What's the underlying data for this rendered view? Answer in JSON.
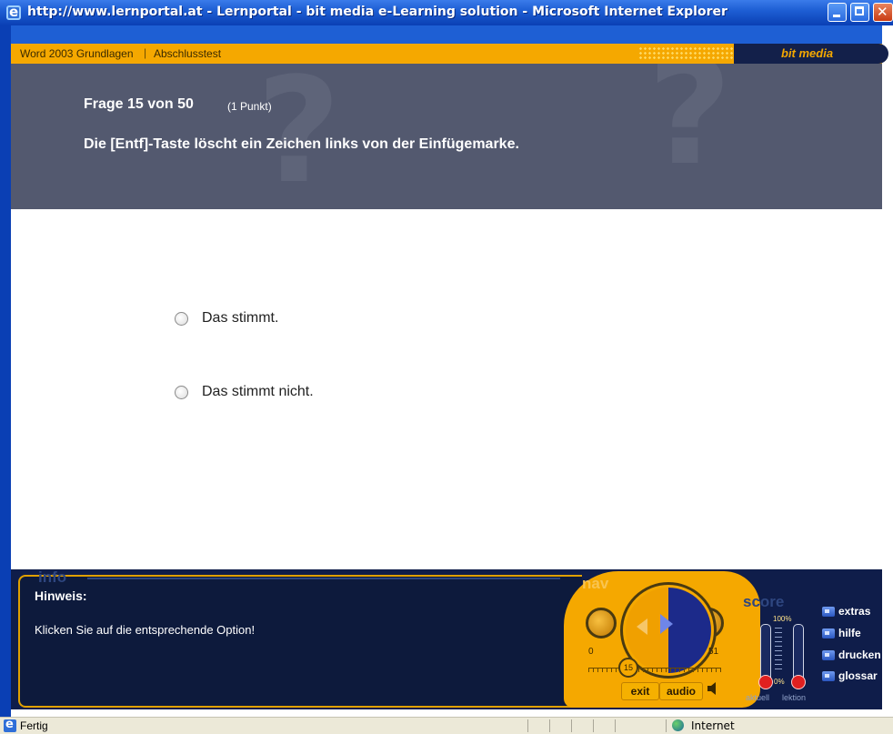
{
  "window": {
    "title": "http://www.lernportal.at - Lernportal - bit media e-Learning solution - Microsoft Internet Explorer"
  },
  "course_bar": {
    "course": "Word 2003 Grundlagen",
    "separator": "|",
    "section": "Abschlusstest",
    "brand": "bit media"
  },
  "question": {
    "number_label": "Frage 15 von 50",
    "points_label": "(1 Punkt)",
    "text": "Die [Entf]-Taste löscht ein Zeichen links von der Einfügemarke."
  },
  "answers": [
    {
      "label": "Das stimmt.",
      "selected": false
    },
    {
      "label": "Das stimmt nicht.",
      "selected": false
    }
  ],
  "info_panel": {
    "title": "info",
    "hint_title": "Hinweis:",
    "hint_text": "Klicken Sie auf die entsprechende Option!"
  },
  "nav": {
    "title": "nav",
    "slider_min": "0",
    "slider_max": "51",
    "slider_value": "15",
    "exit_label": "exit",
    "audio_label": "audio"
  },
  "score": {
    "title": "score",
    "max_label": "100%",
    "min_label": "0%",
    "aktuell_label": "aktuell",
    "lektion_label": "lektion"
  },
  "side_menu": [
    {
      "label": "extras"
    },
    {
      "label": "hilfe"
    },
    {
      "label": "drucken"
    },
    {
      "label": "glossar"
    }
  ],
  "status_bar": {
    "status": "Fertig",
    "zone": "Internet"
  },
  "colors": {
    "accent_orange": "#f5a800",
    "header_gray": "#53596f",
    "panel_navy": "#0f1d4a",
    "titlebar_blue": "#1e5fd4"
  }
}
